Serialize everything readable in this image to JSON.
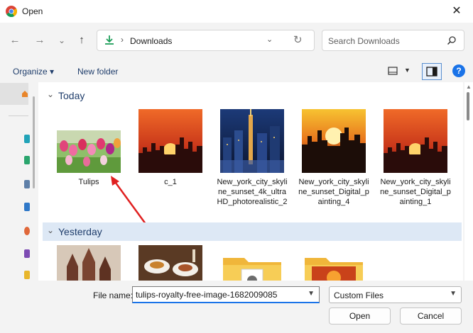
{
  "window": {
    "title": "Open",
    "close_glyph": "✕"
  },
  "nav": {
    "back_icon": "←",
    "forward_icon": "→",
    "dropdown_icon": "⌄",
    "up_icon": "↑",
    "breadcrumb_sep": "›",
    "address": "Downloads",
    "search_placeholder": "Search Downloads"
  },
  "toolbar": {
    "organize_label": "Organize ▾",
    "new_folder_label": "New folder",
    "help_label": "?"
  },
  "groups": [
    {
      "title": "Today",
      "chevron": "⌄"
    },
    {
      "title": "Yesterday",
      "chevron": "⌄"
    }
  ],
  "files_today": [
    {
      "name": "Tulips",
      "thumb": "tulips"
    },
    {
      "name": "c_1",
      "thumb": "sunset-city"
    },
    {
      "name": "New_york_city_skyline_sunset_4k_ultraHD_photorealistic_2",
      "thumb": "nyc-night"
    },
    {
      "name": "New_york_city_skyline_sunset_Digital_painting_4",
      "thumb": "nyc-golden"
    },
    {
      "name": "New_york_city_skyline_sunset_Digital_painting_1",
      "thumb": "sunset-city"
    }
  ],
  "files_yesterday": [
    {
      "thumb": "castle"
    },
    {
      "thumb": "food"
    },
    {
      "thumb": "folder"
    },
    {
      "thumb": "folder-fire"
    }
  ],
  "bottom": {
    "file_name_label": "File name:",
    "file_name_value": "tulips-royalty-free-image-1682009085",
    "file_type_value": "Custom Files",
    "open_label": "Open",
    "cancel_label": "Cancel"
  },
  "colors": {
    "accent": "#1a73e8",
    "header_text": "#1f3d6b",
    "selected_group_bg": "#dde8f5",
    "arrow": "#e02020"
  }
}
